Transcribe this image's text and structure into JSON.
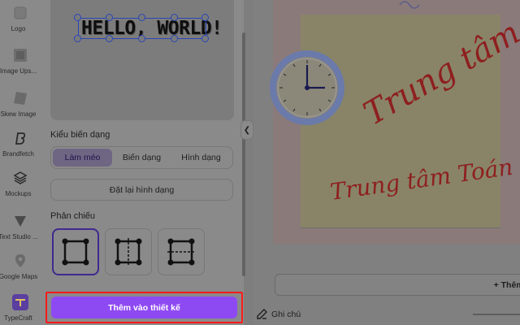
{
  "rail": {
    "items": [
      {
        "label": "Logo",
        "icon": "logo-icon"
      },
      {
        "label": "Image Ups...",
        "icon": "image-upscaler-icon"
      },
      {
        "label": "Skew Image",
        "icon": "skew-image-icon"
      },
      {
        "label": "Brandfetch",
        "icon": "brandfetch-icon"
      },
      {
        "label": "Mockups",
        "icon": "mockups-icon"
      },
      {
        "label": "Text Studio ...",
        "icon": "text-studio-icon"
      },
      {
        "label": "Google Maps",
        "icon": "map-pin-icon"
      },
      {
        "label": "TypeCraft",
        "icon": "typecraft-icon"
      }
    ]
  },
  "panel": {
    "preview_text": "HELLO, WORLD!",
    "warp_type_label": "Kiểu biến dạng",
    "warp_options": [
      "Làm méo",
      "Biến dạng",
      "Hình dạng"
    ],
    "warp_selected": "Làm méo",
    "reset_label": "Đặt lại hình dạng",
    "mirror_label": "Phản chiếu",
    "add_to_design_label": "Thêm vào thiết kế"
  },
  "canvas": {
    "text_large": "Trung tâm",
    "text_small": "Trung tâm Toán",
    "add_page_label": "+ Thêm tra",
    "notes_label": "Ghi chú"
  },
  "colors": {
    "accent": "#8e4af2",
    "highlight_box": "#ff1a1a",
    "selection_blue": "#2a47b8",
    "script_red": "#8e1f1f"
  }
}
